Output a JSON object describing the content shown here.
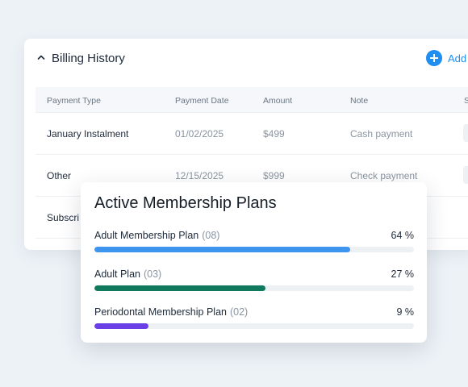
{
  "billing": {
    "title": "Billing History",
    "add_label": "Add",
    "columns": [
      "Payment Type",
      "Payment Date",
      "Amount",
      "Note",
      "S"
    ],
    "rows": [
      {
        "type": "January Instalment",
        "date": "01/02/2025",
        "amount": "$499",
        "note": "Cash payment"
      },
      {
        "type": "Other",
        "date": "12/15/2025",
        "amount": "$999",
        "note": "Check payment"
      },
      {
        "type": "Subscri",
        "date": "",
        "amount": "",
        "note": ""
      }
    ]
  },
  "plans": {
    "title": "Active Membership Plans",
    "items": [
      {
        "name": "Adult Membership Plan",
        "count": "(08)",
        "percent_label": "64 %",
        "fill": 0.8,
        "color": "#3d95ee"
      },
      {
        "name": "Adult Plan",
        "count": "(03)",
        "percent_label": "27 %",
        "fill": 0.535,
        "color": "#117a5e"
      },
      {
        "name": "Periodontal Membership Plan",
        "count": "(02)",
        "percent_label": "9 %",
        "fill": 0.17,
        "color": "#6b3fe6"
      }
    ]
  },
  "colors": {
    "accent": "#1f8ef1",
    "background": "#edf2f7"
  }
}
